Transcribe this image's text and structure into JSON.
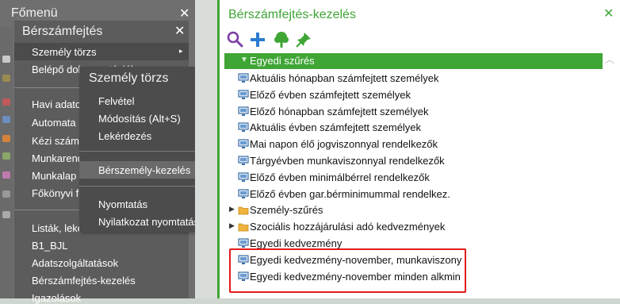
{
  "fomenu": {
    "title": "Főmenü",
    "close": "✕",
    "partial_items": [
      "Havi adato",
      "Automata",
      "Kézi szán",
      "Munkaren",
      "Munkalap",
      "Főkönyvi f"
    ],
    "hidden_item": "Belépő do",
    "partial_lists": "Listák, lek"
  },
  "berszamfejtes": {
    "title": "Bérszámfejtés",
    "close": "✕",
    "items": [
      "Személy törzs",
      "Belépő dokumentációk",
      "Havi adatok",
      "Automata",
      "Kézi számfejtés",
      "Munkarend",
      "Munkalap",
      "Főkönyvi feladás",
      "Listák, lekérdezések",
      "B1_BJL",
      "Adatszolgáltatások",
      "Bérszámfejtés-kezelés",
      "Igazolások"
    ],
    "submenu_arrow": "▸"
  },
  "szemely_torzs": {
    "title": "Személy törzs",
    "close": "✕",
    "items": [
      "Felvétel",
      "Módosítás (Alt+S)",
      "Lekérdezés",
      "Bérszemély-kezelés",
      "Nyomtatás",
      "Nyilatkozat nyomtatás"
    ],
    "highlighted": "Bérszemély-kezelés"
  },
  "panel": {
    "title": "Bérszámfejtés-kezelés",
    "close": "✕",
    "toolbar": {
      "icons": [
        "search-icon",
        "add-icon",
        "tree-icon",
        "pin-icon"
      ]
    },
    "filter_header": "Egyedi szűrés",
    "rows": [
      {
        "label": "Aktuális hónapban számfejtett személyek",
        "type": "item"
      },
      {
        "label": "Előző évben számfejtett személyek",
        "type": "item"
      },
      {
        "label": "Előző hónapban számfejtett személyek",
        "type": "item"
      },
      {
        "label": "Aktuális évben számfejtett személyek",
        "type": "item"
      },
      {
        "label": "Mai napon élő jogviszonnyal rendelkezők",
        "type": "item"
      },
      {
        "label": "Tárgyévben munkaviszonnyal rendelkezők",
        "type": "item"
      },
      {
        "label": "Előző évben minimálbérrel rendelkezők",
        "type": "item"
      },
      {
        "label": "Előző évben gar.bérminimummal rendelkez.",
        "type": "item"
      },
      {
        "label": "Személy-szűrés",
        "type": "folder"
      },
      {
        "label": "Szociális hozzájárulási adó kedvezmények",
        "type": "folder"
      },
      {
        "label": "Egyedi kedvezmény",
        "type": "item"
      },
      {
        "label": "Egyedi kedvezmény-november, munkaviszony",
        "type": "item"
      },
      {
        "label": "Egyedi kedvezmény-november minden alkmin",
        "type": "item"
      }
    ]
  },
  "colors": {
    "accent_green": "#3fa535",
    "highlight_red": "#e21b1b",
    "menu_dark": "#4c4c4c"
  }
}
